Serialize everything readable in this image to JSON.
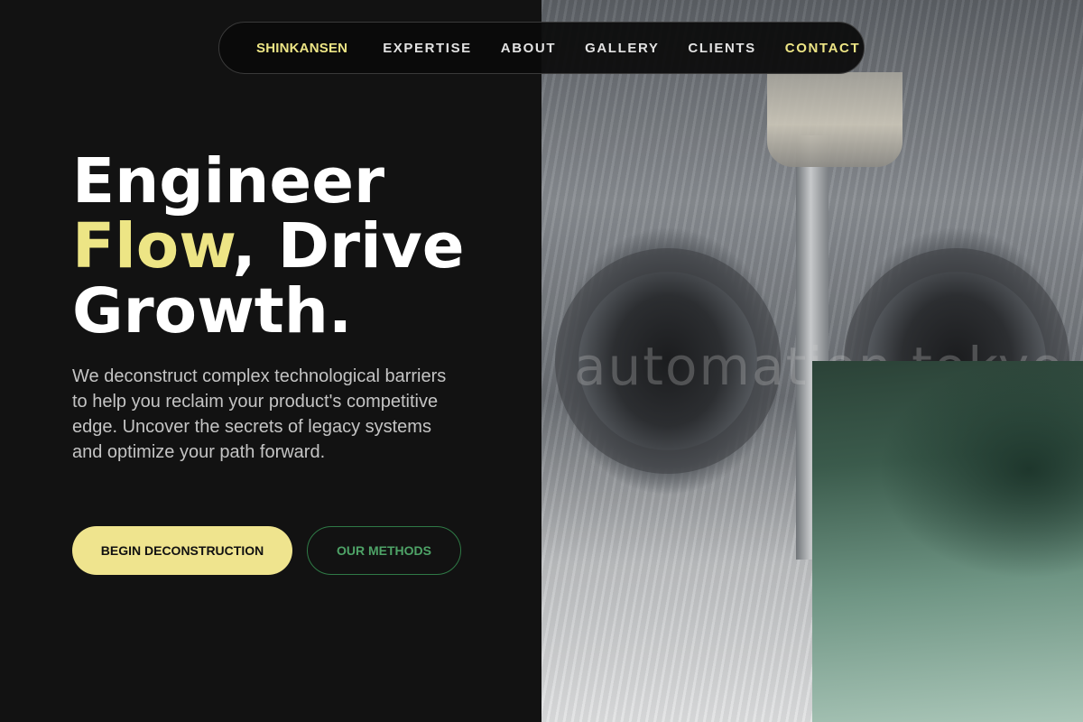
{
  "nav": {
    "brand": "SHINKANSEN",
    "links": [
      "EXPERTISE",
      "ABOUT",
      "GALLERY",
      "CLIENTS",
      "CONTACT"
    ]
  },
  "hero": {
    "headline_line1": "Engineer",
    "headline_highlight": "Flow",
    "headline_line2_rest": ", Drive",
    "headline_line3": "Growth.",
    "description": "We deconstruct complex technological barriers to help you reclaim your product's competitive edge. Uncover the secrets of legacy systems and optimize your path forward.",
    "primary_button": "BEGIN DECONSTRUCTION",
    "secondary_button": "OUR METHODS"
  },
  "image": {
    "watermark": "automation tokyo"
  },
  "colors": {
    "accent_yellow": "#ede585",
    "accent_green": "#4ea367",
    "background": "#121212"
  }
}
